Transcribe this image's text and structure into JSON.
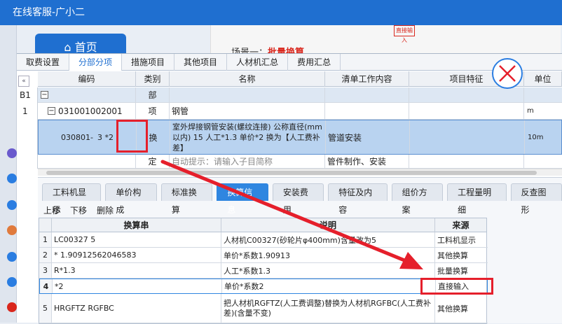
{
  "window": {
    "title": "在线客服-广小二"
  },
  "background": {
    "home_label": "首页",
    "scene_prefix": "场景一：",
    "scene_title": "批量换算",
    "doc_button": "直接输入"
  },
  "top_tabs": [
    "取费设置",
    "分部分项",
    "措施项目",
    "其他项目",
    "人材机汇总",
    "费用汇总"
  ],
  "main_table": {
    "headers": [
      "编码",
      "类别",
      "名称",
      "清单工作内容",
      "项目特征",
      "单位"
    ],
    "rows": [
      {
        "no": "B1",
        "code": "",
        "type": "部",
        "name": "",
        "content": "",
        "unit": ""
      },
      {
        "no": "1",
        "code": "031001002001",
        "type": "项",
        "name": "钢管",
        "content": "",
        "unit": "m"
      },
      {
        "no": "",
        "code": "030801-",
        "code_highlight": "3 *2",
        "type": "换",
        "name": "室外焊接钢管安装(螺纹连接) 公称直径(mm以内) 15  人工*1.3  单价*2  换为【人工费补差】",
        "content": "管道安装",
        "unit": "10m"
      },
      {
        "no": "",
        "code": "",
        "type": "定",
        "name": "自动提示：请输入子目简称",
        "content": "管件制作、安装",
        "unit": ""
      }
    ]
  },
  "sub_tabs": [
    "工料机显示",
    "单价构成",
    "标准换算",
    "换算信息",
    "安装费用",
    "特征及内容",
    "组价方案",
    "工程量明细",
    "反查图形"
  ],
  "toolbar": [
    "上移",
    "下移",
    "删除"
  ],
  "conversion_table": {
    "headers": [
      "换算串",
      "说明",
      "来源"
    ],
    "rows": [
      {
        "no": "1",
        "str": "LC00327 5",
        "desc": "人材机C00327(砂轮片φ400mm)含量改为5",
        "src": "工料机显示"
      },
      {
        "no": "2",
        "str": "* 1.90912562046583",
        "desc": "单价*系数1.90913",
        "src": "其他换算"
      },
      {
        "no": "3",
        "str": "R*1.3",
        "desc": "人工*系数1.3",
        "src": "批量换算"
      },
      {
        "no": "4",
        "str": "*2",
        "desc": "单价*系数2",
        "src": "直接输入"
      },
      {
        "no": "5",
        "str": "HRGFTZ RGFBC",
        "desc": "把人材机RGFTZ(人工费调整)替换为人材机RGFBC(人工费补差)(含量不变)",
        "src": "其他换算"
      }
    ]
  },
  "colors": {
    "accent": "#1f6fd0",
    "highlight": "#e51f2b",
    "selected_row": "#b9d3f0"
  }
}
